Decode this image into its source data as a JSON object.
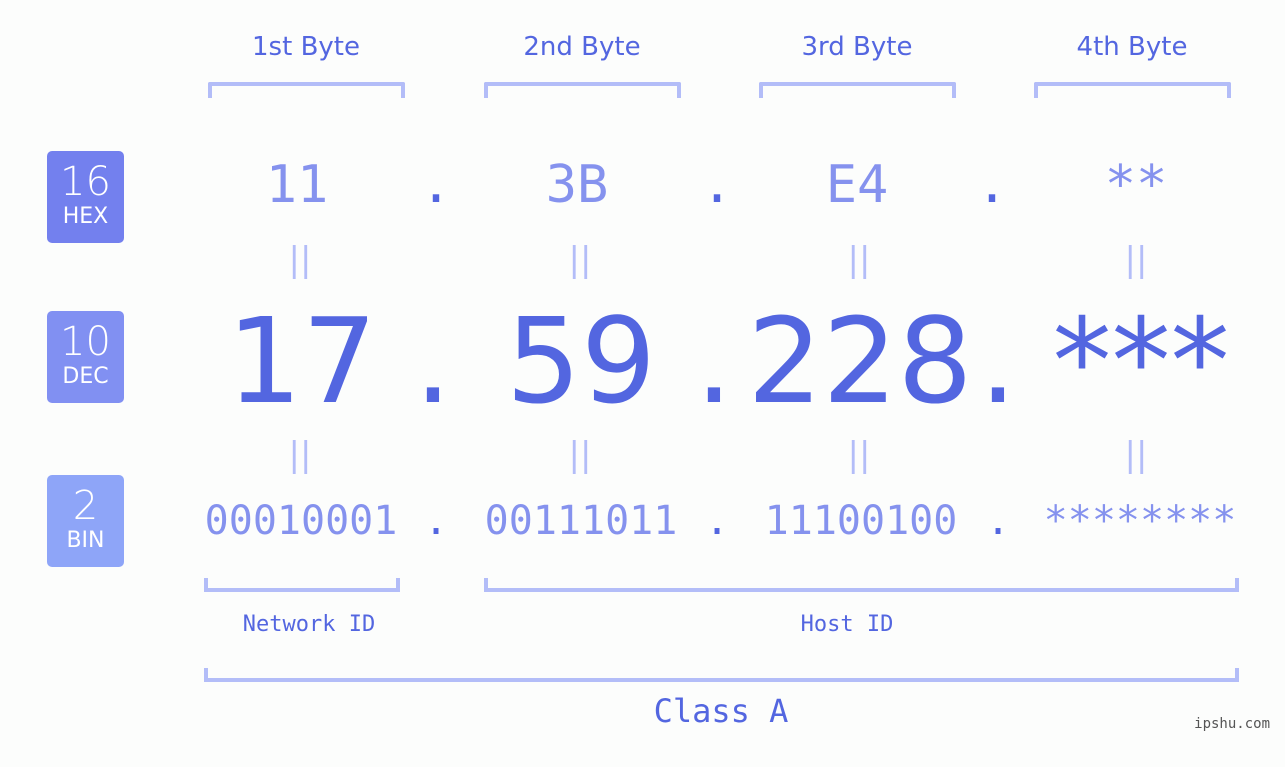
{
  "colors": {
    "hex_badge": "#7380ee",
    "dec_badge": "#8190f2",
    "bin_badge": "#8ea5f8",
    "accent": "#5366e0",
    "muted": "#8592ee",
    "bracket": "#b3bdf8"
  },
  "headers": [
    "1st Byte",
    "2nd Byte",
    "3rd Byte",
    "4th Byte"
  ],
  "badges": {
    "hex": {
      "num": "16",
      "label": "HEX"
    },
    "dec": {
      "num": "10",
      "label": "DEC"
    },
    "bin": {
      "num": "2",
      "label": "BIN"
    }
  },
  "hex": [
    "11",
    "3B",
    "E4",
    "**"
  ],
  "dec": [
    "17",
    "59",
    "228",
    "***"
  ],
  "bin": [
    "00010001",
    "00111011",
    "11100100",
    "********"
  ],
  "separator": ".",
  "equals": "=",
  "network_id_label": "Network ID",
  "host_id_label": "Host ID",
  "class_label": "Class A",
  "watermark": "ipshu.com"
}
